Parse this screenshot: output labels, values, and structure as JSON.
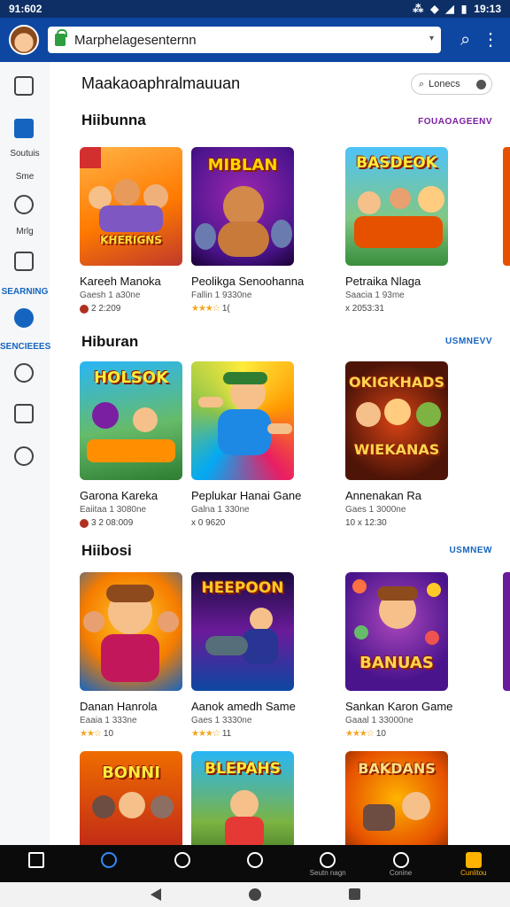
{
  "status": {
    "left": "91:602",
    "right": "19:13"
  },
  "browser": {
    "url": "Marphelagesenternn"
  },
  "sidebar": [
    {
      "label": "",
      "icon": "inbox-icon"
    },
    {
      "label": "Soutuis",
      "icon": "home-icon"
    },
    {
      "label": "Sme",
      "icon": ""
    },
    {
      "label": "",
      "icon": "close-circle-icon"
    },
    {
      "label": "Mrlg",
      "icon": ""
    },
    {
      "label": "",
      "icon": "bookmark-icon"
    },
    {
      "label": "SEARNING",
      "icon": ""
    },
    {
      "label": "",
      "icon": "compass-icon"
    },
    {
      "label": "SENCIEEES",
      "icon": ""
    },
    {
      "label": "",
      "icon": "game-icon"
    },
    {
      "label": "",
      "icon": "download-icon"
    },
    {
      "label": "",
      "icon": "help-icon"
    }
  ],
  "page": {
    "title": "Maakaoaphralmauuan",
    "filter": "Lonecs"
  },
  "sections": [
    {
      "title": "Hiibunna",
      "see_all": "FOUAOAGEENV",
      "games": [
        {
          "title": "Kareeh Manoka",
          "meta": "Gaesh 1 a30ne",
          "rating": "2 2:209",
          "thumb_text": "KHERIGNS",
          "stars": ""
        },
        {
          "title": "Peolikga Senoohanna",
          "meta": "Fallin 1 9330ne",
          "rating": "1(",
          "thumb_text": "MIBLAN",
          "stars": "★★★☆"
        },
        {
          "title": "Petraika Nlaga",
          "meta": "Saacia 1 93me",
          "rating": "x 2053:31",
          "thumb_text": "BASDEOK",
          "stars": ""
        }
      ]
    },
    {
      "title": "Hiburan",
      "see_all": "USMNEVV",
      "games": [
        {
          "title": "Garona Kareka",
          "meta": "Eaiitaa 1 3080ne",
          "rating": "3 2 08:009",
          "thumb_text": "HOLSOK",
          "stars": ""
        },
        {
          "title": "Peplukar Hanai Gane",
          "meta": "Galna 1 330ne",
          "rating": "x 0 9620",
          "thumb_text": "",
          "stars": ""
        },
        {
          "title": "Annenakan Ra",
          "meta": "Gaes 1 3000ne",
          "rating": "10 x 12:30",
          "thumb_text": "OKIGKHADS",
          "stars": ""
        }
      ]
    },
    {
      "title": "Hiibosi",
      "see_all": "USMNEW",
      "games": [
        {
          "title": "Danan Hanrola",
          "meta": "Eaaia 1 333ne",
          "rating": "10",
          "thumb_text": "",
          "stars": "★★☆"
        },
        {
          "title": "Aanok amedh Same",
          "meta": "Gaes 1 3330ne",
          "rating": "11",
          "thumb_text": "HEEPOON",
          "stars": "★★★☆"
        },
        {
          "title": "Sankan Karon Game",
          "meta": "Gaaal 1 33000ne",
          "rating": "10",
          "thumb_text": "BANUAS",
          "stars": "★★★☆"
        }
      ]
    },
    {
      "title": "",
      "see_all": "",
      "games": [
        {
          "title": "",
          "meta": "",
          "rating": "",
          "thumb_text": "BONNI",
          "stars": ""
        },
        {
          "title": "",
          "meta": "",
          "rating": "",
          "thumb_text": "BLEPAHS",
          "stars": ""
        },
        {
          "title": "",
          "meta": "",
          "rating": "",
          "thumb_text": "BAKDANS",
          "stars": ""
        }
      ]
    }
  ],
  "bottom_nav": [
    {
      "label": "",
      "icon": "home-icon"
    },
    {
      "label": "",
      "icon": "explore-icon"
    },
    {
      "label": "",
      "icon": "chat-icon"
    },
    {
      "label": "",
      "icon": "search-icon"
    },
    {
      "label": "Seutn nagn",
      "icon": "profile-icon"
    },
    {
      "label": "Conine",
      "icon": "account-icon"
    },
    {
      "label": "Cunlitou",
      "icon": "lock-icon"
    }
  ],
  "colors": {
    "brand": "#0d47a1",
    "accent_purple": "#7b1fa2",
    "accent_blue": "#1565c0",
    "star": "#f4a51c"
  }
}
